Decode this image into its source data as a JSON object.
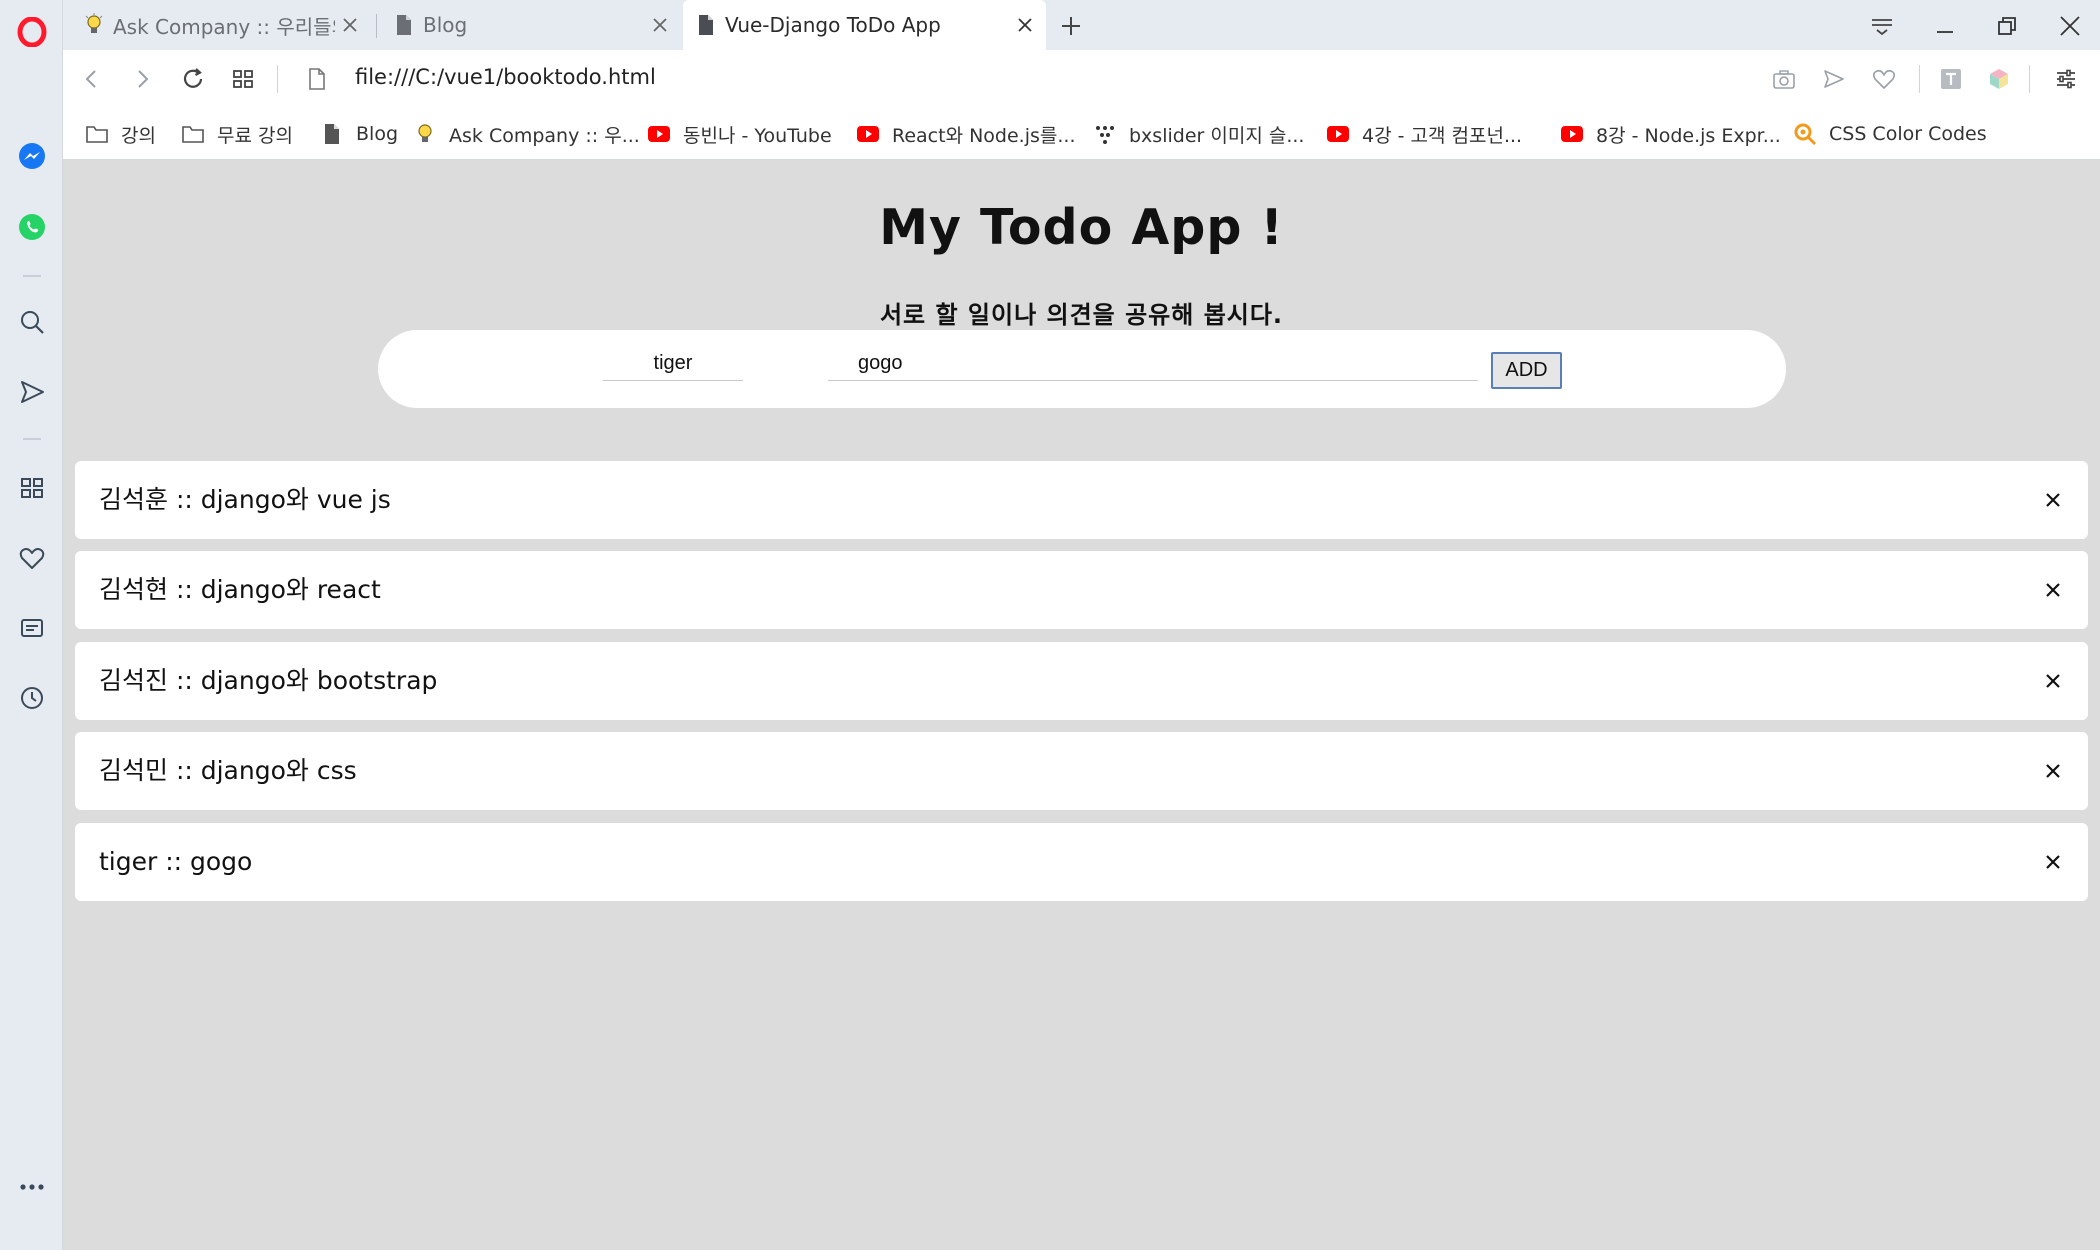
{
  "browser": {
    "tabs": [
      {
        "title": "Ask Company :: 우리들의",
        "active": false,
        "icon": "lightbulb-icon"
      },
      {
        "title": "Blog",
        "active": false,
        "icon": "document-icon"
      },
      {
        "title": "Vue-Django ToDo App",
        "active": true,
        "icon": "document-icon"
      }
    ],
    "url": "file:///C:/vue1/booktodo.html",
    "bookmarks": [
      {
        "label": "강의",
        "icon": "folder-icon"
      },
      {
        "label": "무료 강의",
        "icon": "folder-icon"
      },
      {
        "label": "Blog",
        "icon": "document-icon"
      },
      {
        "label": "Ask Company :: 우...",
        "icon": "lightbulb-icon"
      },
      {
        "label": "동빈나 - YouTube",
        "icon": "youtube-icon"
      },
      {
        "label": "React와 Node.js를...",
        "icon": "youtube-icon"
      },
      {
        "label": "bxslider 이미지 슬...",
        "icon": "dots-icon"
      },
      {
        "label": "4강 - 고객 컴포넌...",
        "icon": "youtube-icon"
      },
      {
        "label": "8강 - Node.js Expr...",
        "icon": "youtube-icon"
      },
      {
        "label": "CSS Color Codes",
        "icon": "search-orange-icon"
      }
    ],
    "accent_color": "#ff1b2d",
    "youtube_color": "#ff0000"
  },
  "app": {
    "title": "My Todo App !",
    "subtitle": "서로 할 일이나 의견을 공유해 봅시다.",
    "form": {
      "name_value": "tiger",
      "text_value": "gogo",
      "add_label": "ADD"
    },
    "todos": [
      {
        "text": "김석훈 :: django와 vue js"
      },
      {
        "text": "김석현 :: django와 react"
      },
      {
        "text": "김석진 :: django와 bootstrap"
      },
      {
        "text": "김석민 :: django와 css"
      },
      {
        "text": "tiger :: gogo"
      }
    ]
  }
}
